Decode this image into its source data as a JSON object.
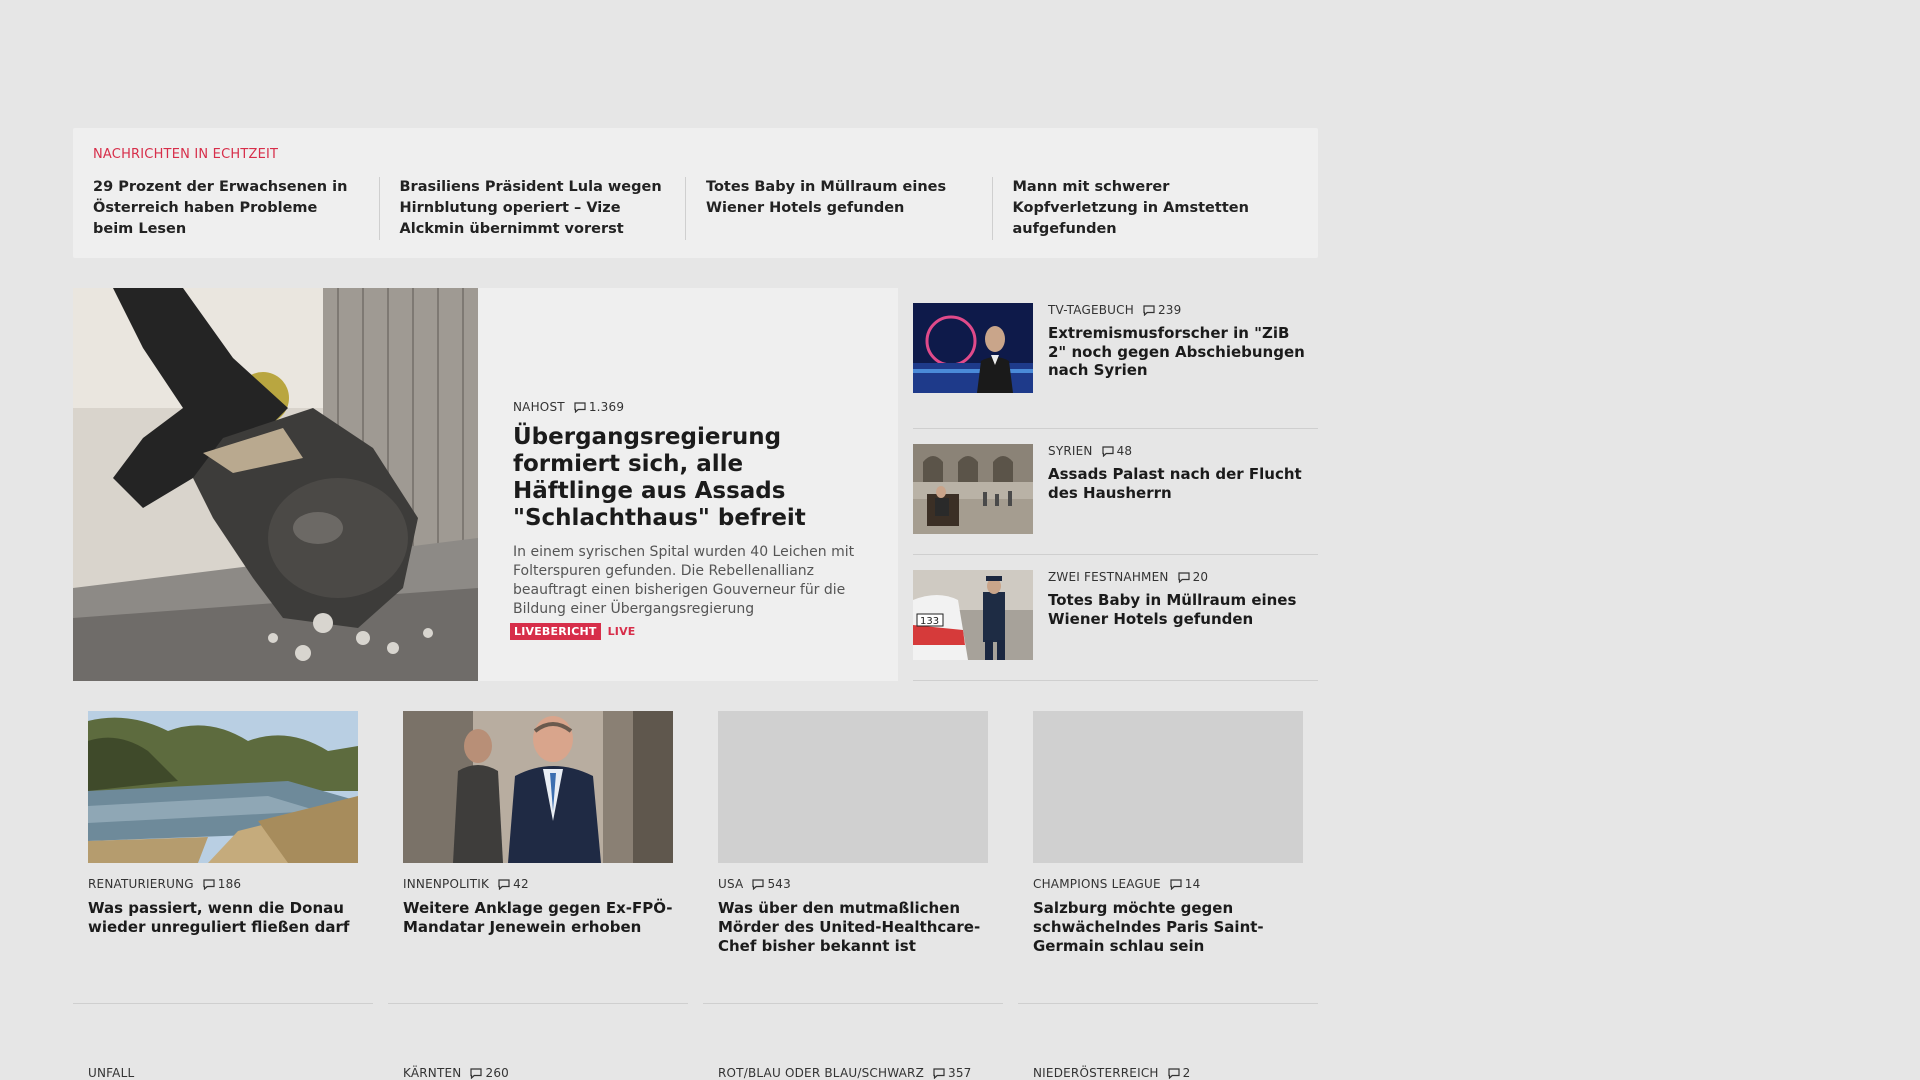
{
  "ticker": {
    "heading": "NACHRICHTEN IN ECHTZEIT",
    "items": [
      "29 Prozent der Erwachsenen in Öster­reich haben Probleme beim Lesen",
      "Brasiliens Präsident Lula wegen Hirn­blutung operiert – Vize Alckmin über­nimmt vorerst",
      "Totes Baby in Müllraum eines Wiener Hotels gefunden",
      "Mann mit schwerer Kopfverletzung in Amstetten aufgefunden"
    ]
  },
  "hero": {
    "kicker": "NAHOST",
    "comments": "1.369",
    "title": "Übergangsregierung formiert sich, alle Häftlinge aus Assads \"Schlachthaus\" befreit",
    "teaser": "In einem syrischen Spital wurden 40 Leichen mit Folterspuren gefunden. Die Rebellenallianz beauftragt einen bisherigen Gouverneur für die Bildung einer Übergangsregierung",
    "badge": "LIVEBERICHT",
    "live": "LIVE"
  },
  "side": [
    {
      "kicker": "TV-TAGEBUCH",
      "comments": "239",
      "title": "Extremismusforscher in \"ZiB 2\" noch gegen Abschiebungen nach Syrien"
    },
    {
      "kicker": "SYRIEN",
      "comments": "48",
      "title": "Assads Palast nach der Flucht des Hausherrn"
    },
    {
      "kicker": "ZWEI FESTNAHMEN",
      "comments": "20",
      "title": "Totes Baby in Müllraum eines Wiener Hotels gefunden"
    }
  ],
  "cards": [
    {
      "kicker": "RENATURIERUNG",
      "comments": "186",
      "title": "Was passiert, wenn die Donau wieder unreguliert fließen darf"
    },
    {
      "kicker": "INNENPOLITIK",
      "comments": "42",
      "title": "Weitere Anklage gegen Ex-FPÖ-Mandatar Jenewein erhoben"
    },
    {
      "kicker": "USA",
      "comments": "543",
      "title": "Was über den mutmaßlichen Mörder des United-Healthcare-Chef bisher bekannt ist"
    },
    {
      "kicker": "CHAMPIONS LEAGUE",
      "comments": "14",
      "title": "Salzburg möchte gegen schwächelndes Paris Saint-Germain schlau sein"
    }
  ],
  "row3": [
    {
      "kicker": "UNFALL",
      "comments": ""
    },
    {
      "kicker": "KÄRNTEN",
      "comments": "260"
    },
    {
      "kicker": "ROT/BLAU ODER BLAU/SCHWARZ",
      "comments": "357"
    },
    {
      "kicker": "NIEDERÖSTERREICH",
      "comments": "2"
    }
  ],
  "icons": {
    "comment": "comment-icon"
  },
  "colors": {
    "accent": "#d72e4a",
    "panel": "#efefef",
    "page": "#e6e6e6"
  }
}
